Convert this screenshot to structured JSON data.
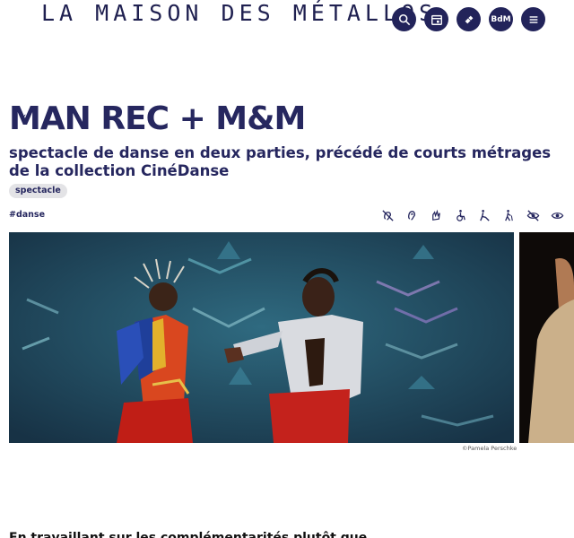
{
  "header": {
    "brand": "LA MAISON DES MÉTALLOS",
    "nav": [
      {
        "name": "search-button",
        "icon": "search-icon"
      },
      {
        "name": "calendar-button",
        "icon": "calendar-icon"
      },
      {
        "name": "ticket-button",
        "icon": "ticket-icon"
      },
      {
        "name": "bdm-button",
        "label": "BdM"
      },
      {
        "name": "menu-button",
        "icon": "hamburger-icon"
      }
    ]
  },
  "event": {
    "title": "MAN REC + M&M",
    "subtitle": "spectacle de danse en deux parties, précédé de courts métrages de la collection CinéDanse",
    "category": "spectacle",
    "hashtag": "#danse",
    "accessibility_icons": [
      "hearing-impaired-icon",
      "ear-icon",
      "sign-language-icon",
      "wheelchair-icon",
      "reduced-mobility-icon",
      "walking-cane-icon",
      "visually-impaired-icon",
      "eye-icon"
    ]
  },
  "media": {
    "credit": "©Pamela Perschke"
  },
  "content": {
    "intro": "En travaillant sur les complémentarités plutôt que"
  },
  "colors": {
    "brand_navy": "#22235a",
    "badge_bg": "#e3e3e6"
  }
}
